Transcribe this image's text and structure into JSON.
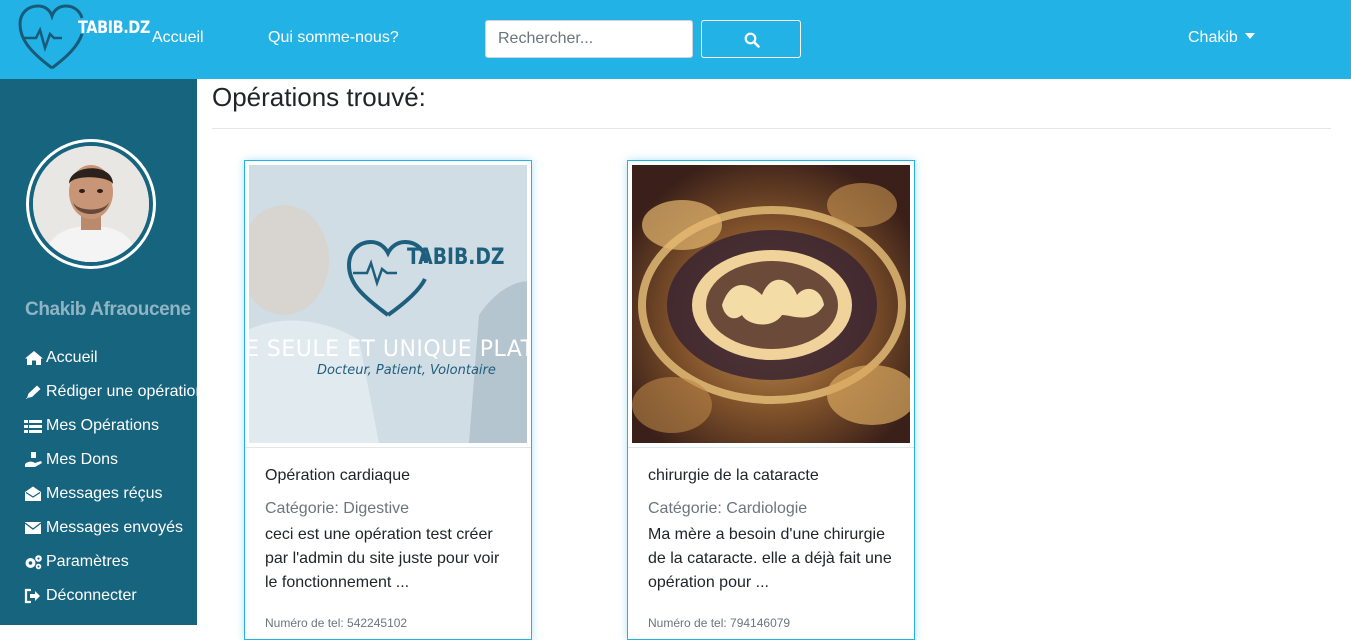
{
  "navbar": {
    "logo_text": "TABIB.DZ",
    "links": [
      "Accueil",
      "Qui somme-nous?"
    ],
    "search_placeholder": "Rechercher...",
    "user": "Chakib"
  },
  "sidebar": {
    "user_name": "Chakib Afraoucene",
    "items": [
      {
        "label": "Accueil",
        "icon": "home-icon"
      },
      {
        "label": "Rédiger une opération",
        "icon": "pen-icon"
      },
      {
        "label": "Mes Opérations",
        "icon": "list-icon"
      },
      {
        "label": "Mes Dons",
        "icon": "donate-icon"
      },
      {
        "label": "Messages réçus",
        "icon": "envelope-open-icon"
      },
      {
        "label": "Messages envoyés",
        "icon": "envelope-icon"
      },
      {
        "label": "Paramètres",
        "icon": "cogs-icon"
      },
      {
        "label": "Déconnecter",
        "icon": "sign-out-icon"
      }
    ]
  },
  "main": {
    "title": "Opérations trouvé:",
    "cards": [
      {
        "title": "Opération cardiaque",
        "category": "Catégorie: Digestive",
        "description": "ceci est une opération test créer par l'admin du site juste pour voir le fonctionnement ...",
        "phone": "Numéro de tel: 542245102",
        "image_brand": "TABIB.DZ",
        "image_caption": "E SEULE ET UNIQUE PLATFO",
        "image_subcaption": "Docteur, Patient, Volontaire"
      },
      {
        "title": "chirurgie de la cataracte",
        "category": "Catégorie: Cardiologie",
        "description": "Ma mère a besoin d'une chirurgie de la cataracte. elle a déjà fait une opération pour ...",
        "phone": "Numéro de tel: 794146079"
      }
    ]
  },
  "colors": {
    "navbar": "#23b2e6",
    "sidebar": "#17647e",
    "card_border": "#23b2e6"
  }
}
